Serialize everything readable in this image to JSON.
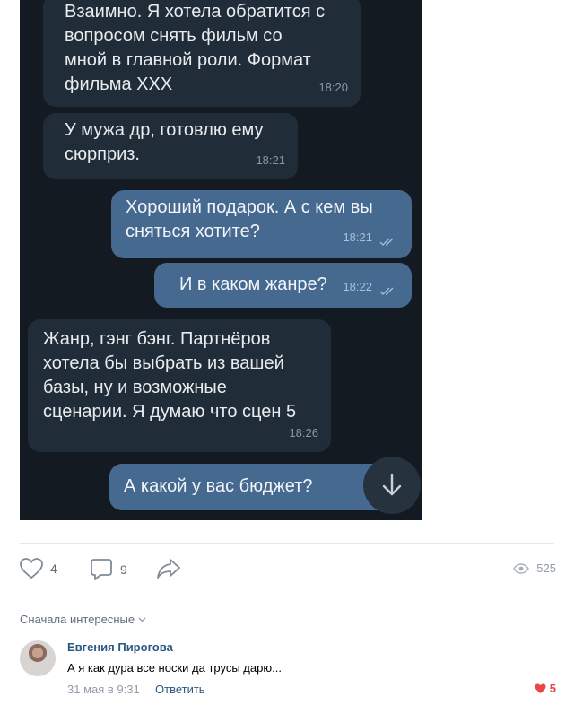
{
  "chat": {
    "messages": [
      {
        "direction": "incoming",
        "text": "Взаимно. Я хотела обратится с\nвопросом снять фильм со\nмной в главной роли. Формат\nфильма XXX",
        "time": "18:20"
      },
      {
        "direction": "incoming",
        "text": "У мужа др, готовлю ему\nсюрприз.",
        "time": "18:21"
      },
      {
        "direction": "outgoing",
        "text": "Хороший подарок. А с кем вы\nсняться хотите?",
        "time": "18:21",
        "read": true
      },
      {
        "direction": "outgoing",
        "text": "И в каком жанре?",
        "time": "18:22",
        "read": true
      },
      {
        "direction": "incoming",
        "text": "Жанр, гэнг бэнг. Партнёров\nхотела бы выбрать из вашей\nбазы, ну и возможные\nсценарии. Я думаю что сцен 5",
        "time": "18:26"
      },
      {
        "direction": "outgoing",
        "text": "А какой у вас бюджет?",
        "time": ""
      }
    ],
    "scroll_down_icon": "arrow-down-icon"
  },
  "post": {
    "likes": "4",
    "comments": "9",
    "views": "525",
    "icons": {
      "like": "heart-icon",
      "comment": "comment-icon",
      "share": "share-icon",
      "views": "eye-icon"
    }
  },
  "comments": {
    "sort_label": "Сначала интересные",
    "items": [
      {
        "author": "Евгения Пирогова",
        "text": "А я как дура все носки да трусы дарю...",
        "date": "31 мая в 9:31",
        "reply_label": "Ответить",
        "likes": "5"
      }
    ]
  },
  "colors": {
    "link": "#2a5885",
    "like_active": "#e64646",
    "bubble_out": "#46698f",
    "bubble_in": "#212c39",
    "chat_bg": "#131a22"
  }
}
